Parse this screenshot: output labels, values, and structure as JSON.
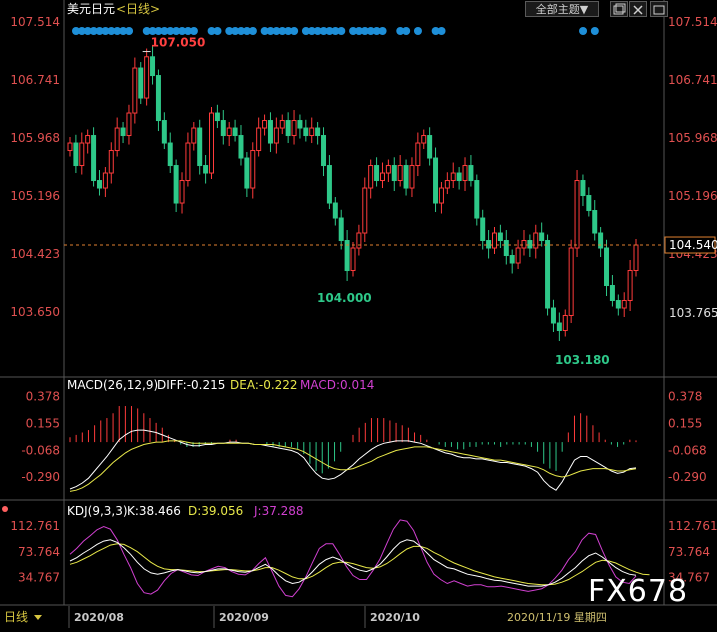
{
  "header": {
    "title": "美元日元",
    "period": "<日线>"
  },
  "controls": {
    "theme_select": "全部主题▼",
    "window_icon": "restore-icon",
    "close_icon": "close-icon"
  },
  "colors": {
    "up": "#ff3b3b",
    "down": "#2ec889",
    "price_red": "#e05050",
    "dea": "#e8e84a",
    "diff": "#ffffff",
    "macd": "#d040d0",
    "dot": "#1e8fd8",
    "k": "#ffffff",
    "d": "#e8e84a",
    "j": "#d040d0",
    "date": "#d0c070",
    "watermark": "#ffffff"
  },
  "chart_data": [
    {
      "type": "candlestick",
      "title": "美元日元 <日线>",
      "ylim": [
        103.18,
        107.514
      ],
      "yticks": [
        "107.514",
        "106.741",
        "105.968",
        "105.196",
        "104.423",
        "103.650"
      ],
      "current_price": "104.540",
      "right_label": "103.765",
      "annotations": {
        "high": "107.050",
        "low1": "104.000",
        "low2": "103.180"
      },
      "x_labels": [
        "2020/08",
        "2020/09",
        "2020/10"
      ],
      "date_label": "2020/11/19 星期四",
      "closes": [
        105.9,
        105.6,
        105.9,
        106.0,
        105.4,
        105.3,
        105.5,
        105.8,
        106.1,
        106.0,
        106.3,
        106.9,
        106.5,
        107.05,
        106.8,
        106.2,
        105.9,
        105.6,
        105.1,
        105.4,
        105.9,
        106.1,
        105.6,
        105.5,
        106.3,
        106.2,
        106.0,
        106.1,
        106.0,
        105.7,
        105.3,
        105.8,
        106.1,
        106.2,
        105.9,
        106.1,
        106.2,
        106.0,
        106.2,
        106.1,
        106.0,
        106.1,
        106.0,
        105.6,
        105.1,
        104.9,
        104.6,
        104.2,
        104.5,
        104.7,
        105.3,
        105.6,
        105.4,
        105.5,
        105.6,
        105.4,
        105.6,
        105.3,
        105.6,
        105.9,
        106.0,
        105.7,
        105.1,
        105.3,
        105.4,
        105.5,
        105.4,
        105.6,
        105.4,
        104.9,
        104.6,
        104.5,
        104.7,
        104.6,
        104.4,
        104.3,
        104.5,
        104.6,
        104.5,
        104.7,
        104.6,
        103.7,
        103.5,
        103.4,
        103.6,
        104.5,
        105.4,
        105.2,
        105.0,
        104.7,
        104.5,
        104.0,
        103.8,
        103.7,
        103.8,
        104.2,
        104.54
      ],
      "macd": {
        "label": "MACD(26,12,9)",
        "diff_text": "DIFF:-0.215",
        "dea_text": "DEA:-0.222",
        "macd_text": "MACD:0.014",
        "yticks": [
          "0.378",
          "0.155",
          "-0.068",
          "-0.290"
        ],
        "ylim": [
          -0.44,
          0.45
        ],
        "diff": [
          -0.39,
          -0.37,
          -0.34,
          -0.3,
          -0.24,
          -0.18,
          -0.12,
          -0.05,
          0.02,
          0.06,
          0.09,
          0.1,
          0.1,
          0.09,
          0.08,
          0.06,
          0.04,
          0.02,
          0.0,
          -0.02,
          -0.03,
          -0.03,
          -0.02,
          -0.02,
          -0.01,
          -0.01,
          0.0,
          0.0,
          -0.01,
          -0.01,
          -0.02,
          -0.02,
          -0.03,
          -0.04,
          -0.05,
          -0.06,
          -0.07,
          -0.09,
          -0.13,
          -0.2,
          -0.26,
          -0.3,
          -0.31,
          -0.3,
          -0.27,
          -0.23,
          -0.19,
          -0.14,
          -0.1,
          -0.06,
          -0.03,
          -0.01,
          0.0,
          0.01,
          0.01,
          0.01,
          0.0,
          -0.01,
          -0.03,
          -0.05,
          -0.07,
          -0.09,
          -0.1,
          -0.12,
          -0.13,
          -0.13,
          -0.14,
          -0.14,
          -0.15,
          -0.16,
          -0.17,
          -0.17,
          -0.18,
          -0.19,
          -0.2,
          -0.22,
          -0.25,
          -0.32,
          -0.37,
          -0.4,
          -0.33,
          -0.24,
          -0.15,
          -0.12,
          -0.12,
          -0.15,
          -0.18,
          -0.21,
          -0.24,
          -0.26,
          -0.25,
          -0.22,
          -0.215
        ],
        "dea": [
          -0.41,
          -0.4,
          -0.38,
          -0.35,
          -0.31,
          -0.27,
          -0.22,
          -0.17,
          -0.13,
          -0.09,
          -0.06,
          -0.04,
          -0.02,
          -0.01,
          0.0,
          0.0,
          0.01,
          0.01,
          0.01,
          0.0,
          -0.01,
          -0.01,
          -0.01,
          -0.01,
          -0.01,
          -0.01,
          -0.01,
          -0.01,
          -0.01,
          -0.01,
          -0.02,
          -0.02,
          -0.02,
          -0.02,
          -0.03,
          -0.04,
          -0.05,
          -0.06,
          -0.08,
          -0.11,
          -0.14,
          -0.17,
          -0.2,
          -0.22,
          -0.23,
          -0.23,
          -0.22,
          -0.2,
          -0.18,
          -0.16,
          -0.13,
          -0.11,
          -0.09,
          -0.07,
          -0.06,
          -0.05,
          -0.04,
          -0.04,
          -0.04,
          -0.05,
          -0.06,
          -0.07,
          -0.08,
          -0.09,
          -0.1,
          -0.11,
          -0.12,
          -0.13,
          -0.14,
          -0.15,
          -0.15,
          -0.16,
          -0.17,
          -0.18,
          -0.19,
          -0.2,
          -0.21,
          -0.23,
          -0.26,
          -0.28,
          -0.29,
          -0.28,
          -0.26,
          -0.24,
          -0.23,
          -0.22,
          -0.22,
          -0.22,
          -0.23,
          -0.24,
          -0.24,
          -0.23,
          -0.222
        ]
      },
      "kdj": {
        "label": "KDJ(9,3,3)",
        "k_text": "K:38.466",
        "d_text": "D:39.056",
        "j_text": "J:37.288",
        "yticks": [
          "112.761",
          "73.764",
          "34.767"
        ],
        "ylim": [
          -5,
          140
        ],
        "k": [
          60,
          65,
          72,
          78,
          85,
          90,
          92,
          88,
          80,
          70,
          58,
          48,
          42,
          40,
          42,
          45,
          47,
          45,
          43,
          42,
          44,
          46,
          48,
          48,
          46,
          44,
          43,
          45,
          50,
          55,
          48,
          38,
          30,
          26,
          28,
          34,
          44,
          55,
          62,
          66,
          62,
          56,
          50,
          46,
          44,
          48,
          55,
          66,
          78,
          88,
          92,
          90,
          82,
          72,
          62,
          56,
          50,
          48,
          44,
          40,
          38,
          36,
          33,
          31,
          30,
          28,
          26,
          24,
          22,
          22,
          22,
          24,
          28,
          34,
          42,
          50,
          60,
          68,
          72,
          66,
          58,
          50,
          44,
          40,
          38.466
        ],
        "d": [
          55,
          58,
          63,
          68,
          74,
          79,
          84,
          86,
          85,
          80,
          74,
          66,
          58,
          52,
          48,
          47,
          47,
          46,
          45,
          44,
          44,
          45,
          46,
          47,
          47,
          46,
          45,
          45,
          47,
          50,
          50,
          46,
          41,
          36,
          33,
          33,
          37,
          43,
          50,
          56,
          58,
          58,
          56,
          53,
          50,
          49,
          51,
          56,
          63,
          71,
          78,
          82,
          82,
          79,
          73,
          68,
          62,
          57,
          53,
          49,
          45,
          42,
          39,
          36,
          34,
          32,
          30,
          28,
          26,
          25,
          24,
          24,
          25,
          28,
          32,
          38,
          44,
          51,
          58,
          61,
          60,
          57,
          52,
          47,
          43,
          40,
          39.056
        ],
        "j": [
          70,
          79,
          90,
          98,
          107,
          112,
          108,
          92,
          70,
          50,
          26,
          12,
          10,
          16,
          30,
          41,
          47,
          43,
          39,
          38,
          44,
          48,
          52,
          50,
          44,
          40,
          39,
          45,
          56,
          65,
          44,
          22,
          8,
          6,
          18,
          36,
          58,
          79,
          86,
          86,
          70,
          52,
          38,
          32,
          32,
          46,
          63,
          86,
          108,
          122,
          120,
          106,
          82,
          58,
          40,
          32,
          26,
          30,
          26,
          22,
          24,
          24,
          21,
          21,
          22,
          20,
          18,
          16,
          14,
          16,
          18,
          24,
          34,
          46,
          62,
          74,
          92,
          102,
          100,
          76,
          54,
          36,
          28,
          26,
          37.288
        ]
      }
    }
  ],
  "watermark": "FX678"
}
